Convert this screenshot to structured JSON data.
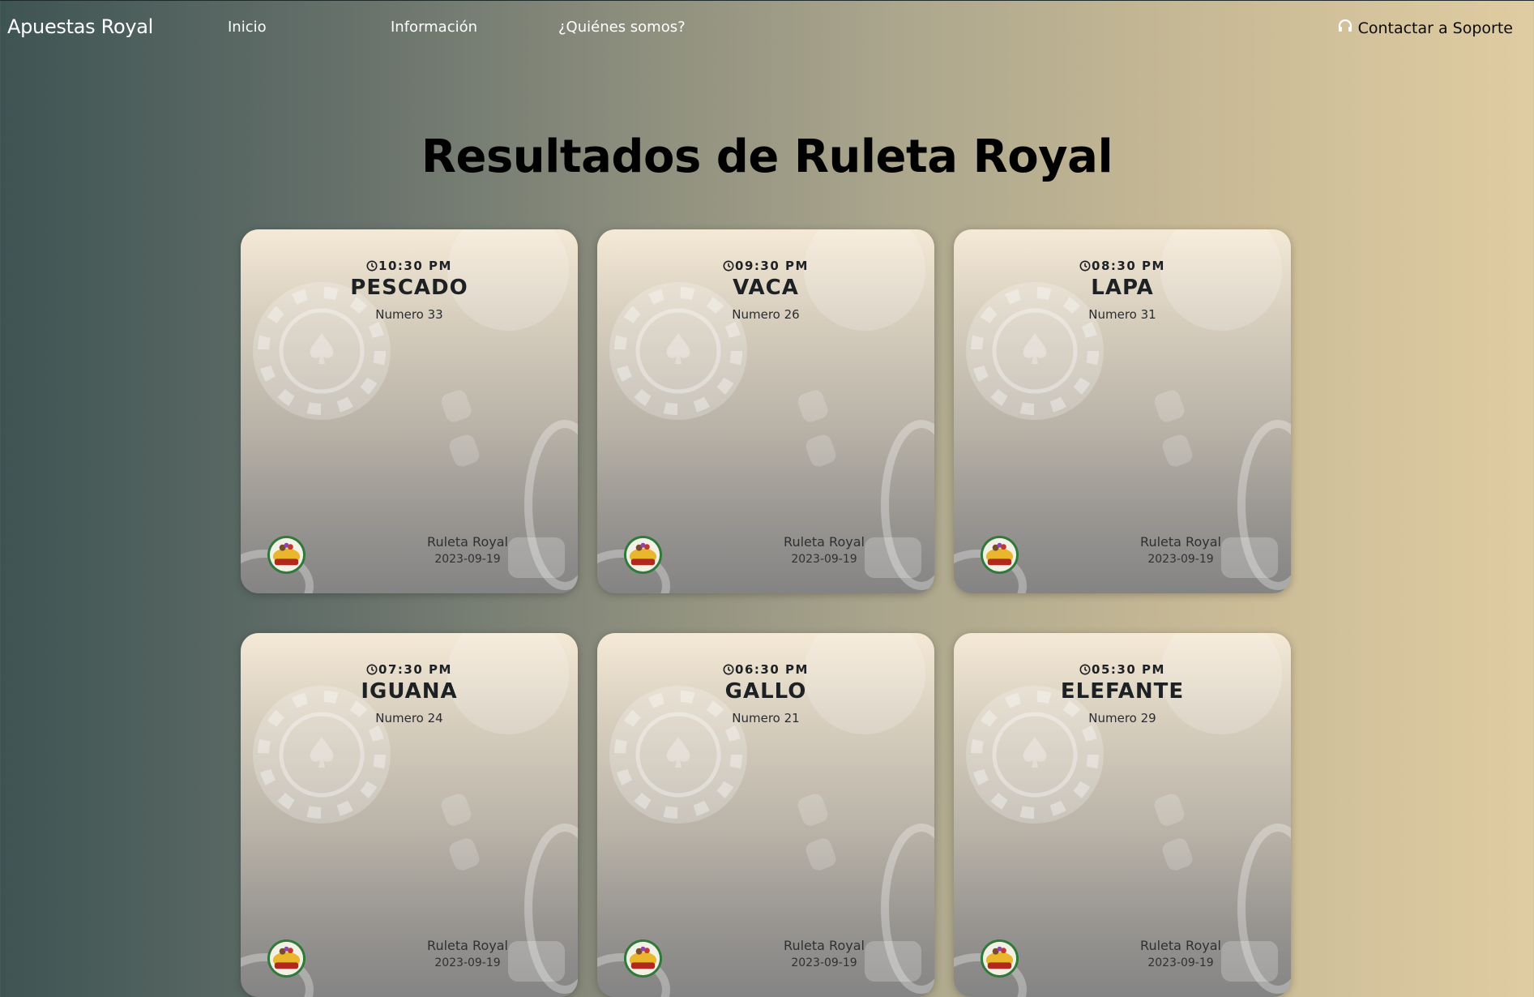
{
  "nav": {
    "brand": "Apuestas Royal",
    "links": [
      "Inicio",
      "Información",
      "¿Quiénes somos?"
    ],
    "support": "Contactar a Soporte",
    "support_icon": "headphones-icon"
  },
  "page": {
    "title": "Resultados de Ruleta Royal"
  },
  "colors": {
    "gradient_left": "#3e5453",
    "gradient_right": "#e0cca2",
    "card_top": "#f5e9d6",
    "card_bottom": "#848484"
  },
  "results": [
    {
      "time": "10:30 PM",
      "animal": "PESCADO",
      "numero": "Numero 33",
      "game": "Ruleta Royal",
      "date": "2023-09-19"
    },
    {
      "time": "09:30 PM",
      "animal": "VACA",
      "numero": "Numero 26",
      "game": "Ruleta Royal",
      "date": "2023-09-19"
    },
    {
      "time": "08:30 PM",
      "animal": "LAPA",
      "numero": "Numero 31",
      "game": "Ruleta Royal",
      "date": "2023-09-19"
    },
    {
      "time": "07:30 PM",
      "animal": "IGUANA",
      "numero": "Numero 24",
      "game": "Ruleta Royal",
      "date": "2023-09-19"
    },
    {
      "time": "06:30 PM",
      "animal": "GALLO",
      "numero": "Numero 21",
      "game": "Ruleta Royal",
      "date": "2023-09-19"
    },
    {
      "time": "05:30 PM",
      "animal": "ELEFANTE",
      "numero": "Numero 29",
      "game": "Ruleta Royal",
      "date": "2023-09-19"
    }
  ]
}
